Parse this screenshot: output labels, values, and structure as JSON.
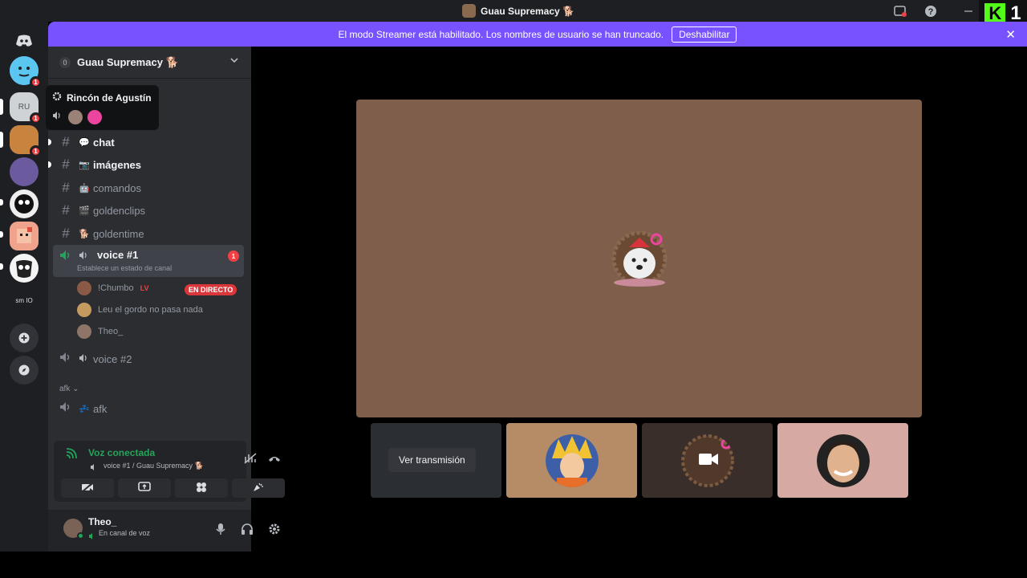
{
  "window": {
    "title": "Guau Supremacy 🐕"
  },
  "titlebar": {
    "icons": [
      "inbox-icon",
      "help-icon",
      "minimize-icon"
    ],
    "kick_logo_letter": "K",
    "kick_logo_number": "1"
  },
  "banner": {
    "message": "El modo Streamer está habilitado. Los nombres de usuario se han truncado.",
    "button": "Deshabilitar",
    "close": "✕"
  },
  "rail": {
    "servers": [
      {
        "label": "",
        "badge": ""
      },
      {
        "label": "",
        "badge": "1"
      },
      {
        "label": "RU",
        "badge": "1"
      },
      {
        "label": "",
        "badge": "1"
      },
      {
        "label": "",
        "badge": ""
      },
      {
        "label": "",
        "badge": ""
      },
      {
        "label": "",
        "badge": ""
      },
      {
        "label": "",
        "badge": ""
      },
      {
        "label": "sm IO",
        "badge": ""
      }
    ]
  },
  "guild": {
    "mention_count": "0",
    "name": "Guau Supremacy 🐕"
  },
  "tooltip": {
    "title": "Rincón de Agustín"
  },
  "channels": [
    {
      "name": "chat",
      "emoji": "💬",
      "type": "text",
      "unread": true
    },
    {
      "name": "imágenes",
      "emoji": "📷",
      "type": "text",
      "unread": true
    },
    {
      "name": "comandos",
      "emoji": "🤖",
      "type": "text",
      "unread": false
    },
    {
      "name": "goldenclips",
      "emoji": "🎬",
      "type": "text",
      "unread": false
    },
    {
      "name": "goldentime",
      "emoji": "🐕",
      "type": "text",
      "unread": false
    }
  ],
  "voice_channel_1": {
    "name": "voice #1",
    "status": "Establece un estado de canal",
    "badge": "1",
    "users": [
      {
        "name": "!Chumbo",
        "tag": "LV",
        "live": "EN DIRECTO"
      },
      {
        "name": "Leu el gordo no pasa nada"
      },
      {
        "name": "Theo_"
      }
    ]
  },
  "voice_channel_2": {
    "name": "voice #2"
  },
  "category_afk": {
    "name": "afk"
  },
  "afk_channel": {
    "name": "afk",
    "emoji": "💤"
  },
  "voice_panel": {
    "title": "Voz conectada",
    "subtitle": "voice #1 / Guau Supremacy 🐕",
    "buttons": [
      "camera-off-icon",
      "screenshare-icon",
      "activities-icon",
      "soundboard-icon"
    ]
  },
  "user": {
    "name": "Theo_",
    "status": "En canal de voz"
  },
  "tiles": [
    {
      "button": "Ver transmisión"
    },
    {
      "kind": "avatar"
    },
    {
      "kind": "camera"
    },
    {
      "kind": "avatar"
    }
  ],
  "colors": {
    "accent": "#7752fe",
    "voice_green": "#23a559",
    "live_red": "#da373c",
    "stage_bg": "#7f5e4c"
  }
}
